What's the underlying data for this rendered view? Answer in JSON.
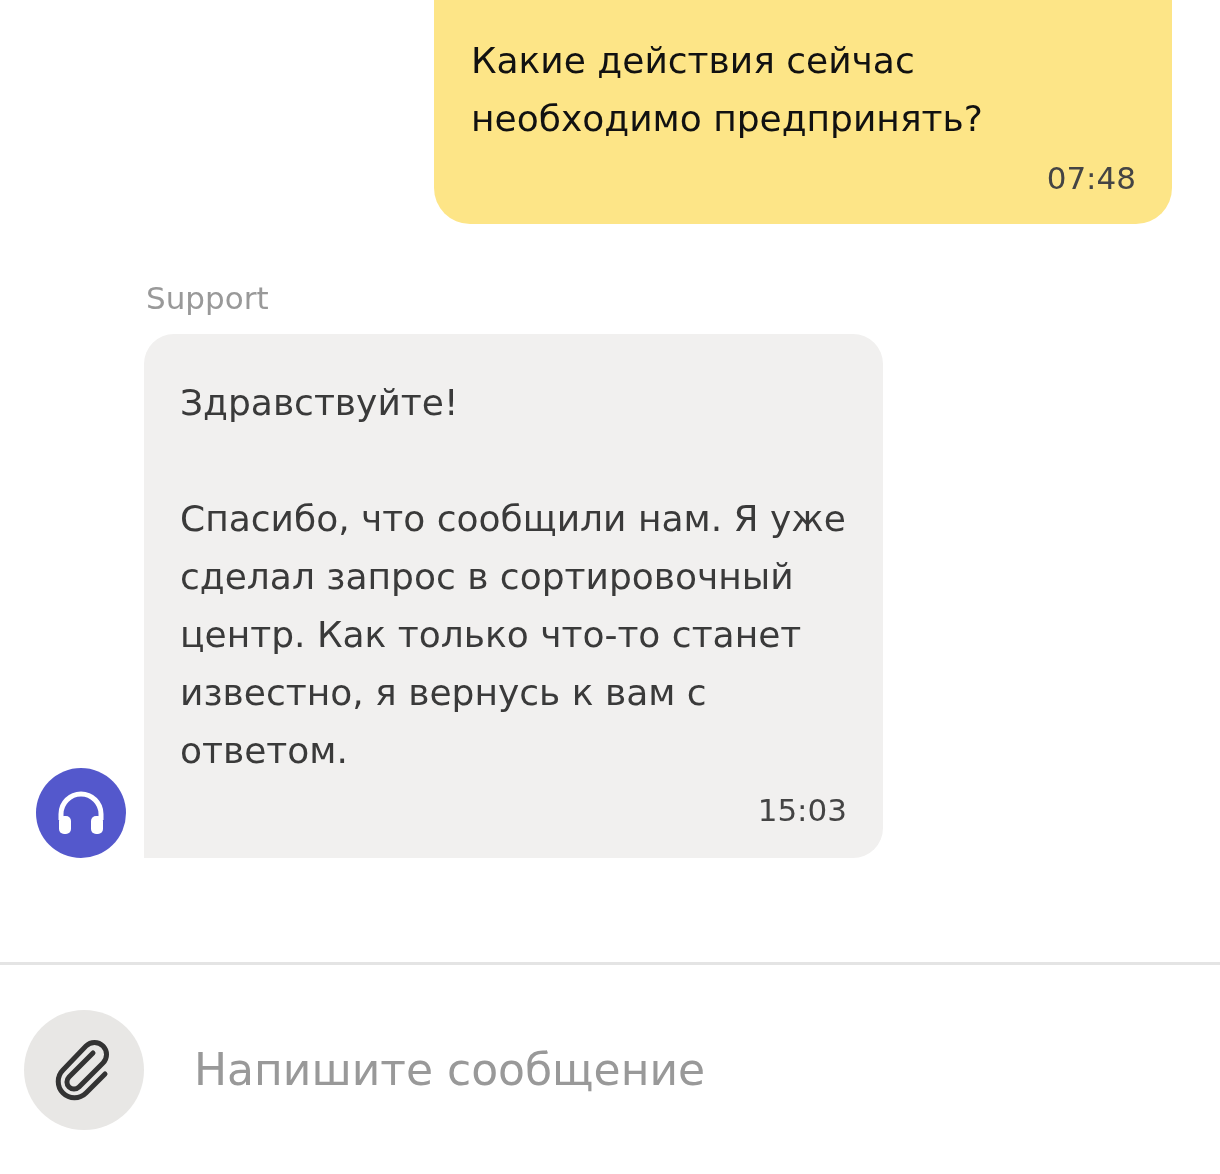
{
  "messages": [
    {
      "kind": "outgoing",
      "paragraphs": [
        "Какие действия сейчас необходимо предпринять?"
      ],
      "time": "07:48"
    },
    {
      "kind": "incoming",
      "sender": "Support",
      "paragraphs": [
        "Здравствуйте!",
        "Спасибо, что сообщили нам. Я уже сделал запрос в сортировочный центр. Как только что-то станет известно, я вернусь к вам с ответом."
      ],
      "time": "15:03"
    }
  ],
  "composer": {
    "placeholder": "Напишите сообщение"
  }
}
